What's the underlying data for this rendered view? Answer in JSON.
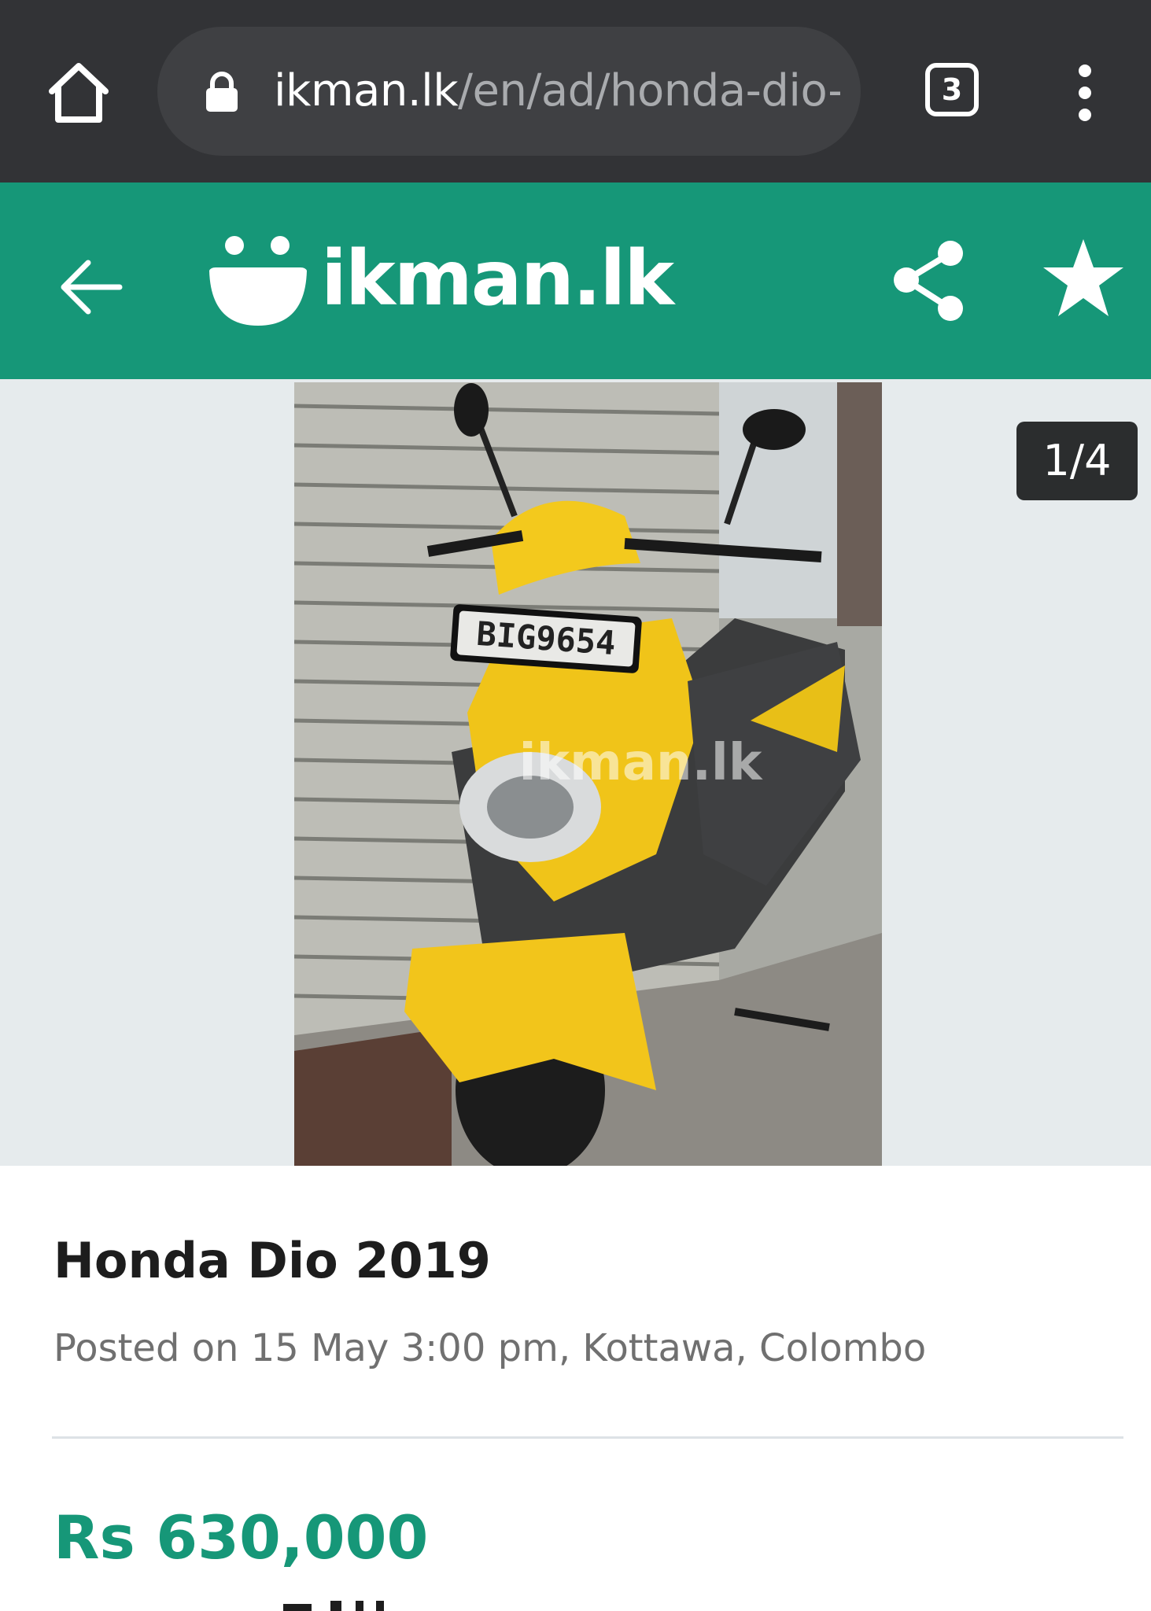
{
  "browser": {
    "url_domain": "ikman.lk",
    "url_path": "/en/ad/honda-dio-",
    "tab_count": "3",
    "icons": [
      "home-icon",
      "lock-icon",
      "tabs-icon",
      "more-vert-icon"
    ]
  },
  "header": {
    "logo_text": "ikman.lk",
    "brand_color": "#169778",
    "icons": [
      "arrow-left-icon",
      "ikman-logo-icon",
      "share-icon",
      "star-icon"
    ]
  },
  "gallery": {
    "counter": "1/4",
    "photo_plate": "BIG9654",
    "photo_watermark": "ikman.lk"
  },
  "ad": {
    "title": "Honda Dio 2019",
    "posted": "Posted on 15 May 3:00 pm, Kottawa, Colombo",
    "price": "Rs 630,000",
    "price_color": "#169778"
  }
}
